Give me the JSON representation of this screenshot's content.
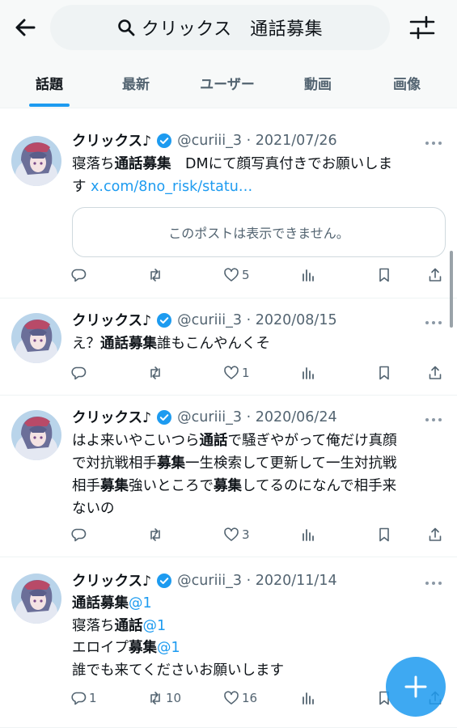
{
  "header": {
    "search_query": "クリックス　通話募集"
  },
  "tabs": [
    {
      "label": "話題",
      "active": true
    },
    {
      "label": "最新",
      "active": false
    },
    {
      "label": "ユーザー",
      "active": false
    },
    {
      "label": "動画",
      "active": false
    },
    {
      "label": "画像",
      "active": false
    }
  ],
  "icons": {
    "back": "back-arrow-icon",
    "search": "search-icon",
    "filter": "filter-sliders-icon",
    "verified": "verified-badge-icon",
    "reply": "reply-icon",
    "repost": "repost-icon",
    "like": "heart-icon",
    "views": "views-chart-icon",
    "bookmark": "bookmark-icon",
    "share": "share-icon",
    "compose": "plus-icon"
  },
  "colors": {
    "accent": "#1d9bf0",
    "text": "#0f1419",
    "muted": "#536471"
  },
  "posts": [
    {
      "name": "クリックス♪",
      "handle_date": "@curiii_3 · 2021/07/26",
      "lines": [
        {
          "pre": "寝落ち",
          "bold": "通話募集",
          "post": "　DMにて顔写真付きでお願いしま"
        },
        {
          "pre": "す ",
          "link": "x.com/8no_risk/statu…"
        }
      ],
      "quote": "このポストは表示できません。",
      "reply_count": "",
      "repost_count": "",
      "like_count": "5"
    },
    {
      "name": "クリックス♪",
      "handle_date": "@curiii_3 · 2020/08/15",
      "lines": [
        {
          "pre": "え？",
          "bold": "通話募集",
          "post": "誰もこんやんくそ"
        }
      ],
      "reply_count": "",
      "repost_count": "",
      "like_count": "1"
    },
    {
      "name": "クリックス♪",
      "handle_date": "@curiii_3 · 2020/06/24",
      "lines": [
        {
          "pre": "はよ来いやこいつら",
          "bold": "通話",
          "post": "で騒ぎやがって俺だけ真顔"
        },
        {
          "pre": "で対抗戦相手",
          "bold": "募集",
          "post": "一生検索して更新して一生対抗戦"
        },
        {
          "pre": "相手",
          "bold": "募集",
          "post": "強いところで",
          "bold2": "募集",
          "post2": "してるのになんで相手来"
        },
        {
          "pre": "ないの"
        }
      ],
      "reply_count": "",
      "repost_count": "",
      "like_count": "3"
    },
    {
      "name": "クリックス♪",
      "handle_date": "@curiii_3 · 2020/11/14",
      "lines": [
        {
          "bold": "通話募集",
          "mention": "@1"
        },
        {
          "pre": "寝落ち",
          "bold": "通話",
          "mention": "@1"
        },
        {
          "pre": "エロイプ",
          "bold": "募集",
          "mention": "@1"
        },
        {
          "pre": "誰でも来てくださいお願いします"
        }
      ],
      "reply_count": "1",
      "repost_count": "10",
      "like_count": "16"
    }
  ]
}
